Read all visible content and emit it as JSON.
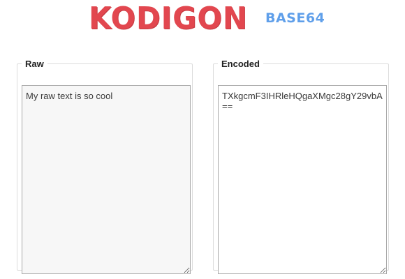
{
  "header": {
    "logo_text": "Kodigon",
    "subtitle": "Base64"
  },
  "raw_panel": {
    "legend": "Raw",
    "value": "My raw text is so cool"
  },
  "encoded_panel": {
    "legend": "Encoded",
    "value": "TXkgcmF3IHRleHQgaXMgc28gY29vbA=="
  },
  "colors": {
    "logo": "#e2474f",
    "subtitle": "#5f9fea",
    "panel_border": "#dcdcdc",
    "textarea_border": "#a9a9a9",
    "raw_background": "#f7f7f7"
  }
}
